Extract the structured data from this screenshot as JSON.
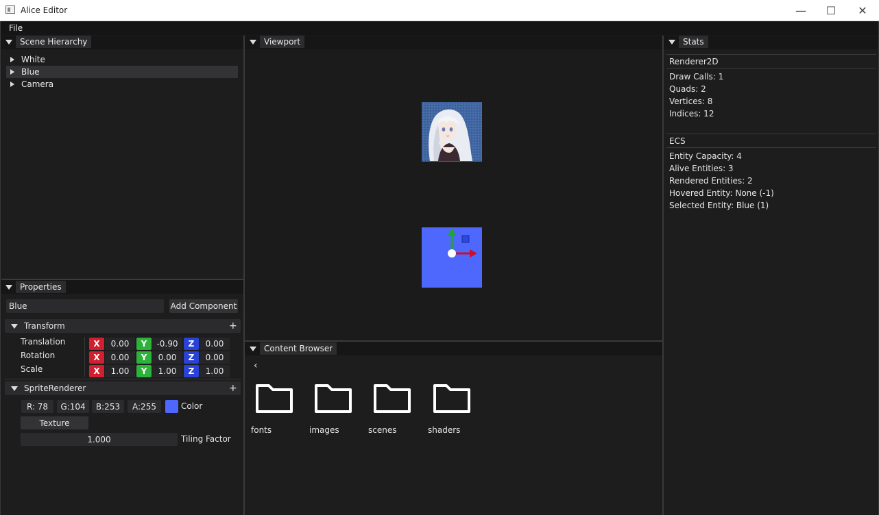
{
  "window": {
    "title": "Alice Editor",
    "controls": {
      "minimize": "—",
      "maximize": "☐",
      "close": "✕"
    }
  },
  "menu": {
    "file": "File"
  },
  "hierarchy": {
    "tab": "Scene Hierarchy",
    "items": [
      {
        "label": "White"
      },
      {
        "label": "Blue",
        "selected": true
      },
      {
        "label": "Camera"
      }
    ]
  },
  "properties": {
    "tab": "Properties",
    "name_value": "Blue",
    "add_component": "Add Component",
    "transform": {
      "header": "Transform",
      "add": "+",
      "rows": [
        {
          "label": "Translation",
          "x": "0.00",
          "y": "-0.90",
          "z": "0.00"
        },
        {
          "label": "Rotation",
          "x": "0.00",
          "y": "0.00",
          "z": "0.00"
        },
        {
          "label": "Scale",
          "x": "1.00",
          "y": "1.00",
          "z": "1.00"
        }
      ],
      "axis_labels": {
        "x": "X",
        "y": "Y",
        "z": "Z"
      }
    },
    "sprite": {
      "header": "SpriteRenderer",
      "add": "+",
      "r": "R: 78",
      "g": "G:104",
      "b": "B:253",
      "a": "A:255",
      "color_label": "Color",
      "color_swatch": "#4e68fd",
      "texture": "Texture",
      "tiling_value": "1.000",
      "tiling_label": "Tiling Factor"
    }
  },
  "viewport": {
    "tab": "Viewport"
  },
  "content_browser": {
    "tab": "Content Browser",
    "back": "‹",
    "folders": [
      "fonts",
      "images",
      "scenes",
      "shaders"
    ]
  },
  "stats": {
    "tab": "Stats",
    "renderer_header": "Renderer2D",
    "renderer_lines": [
      "Draw Calls: 1",
      "Quads: 2",
      "Vertices: 8",
      "Indices: 12"
    ],
    "ecs_header": "ECS",
    "ecs_lines": [
      "Entity Capacity: 4",
      "Alive Entities: 3",
      "Rendered Entities: 2",
      "Hovered Entity: None (-1)",
      "Selected Entity: Blue (1)"
    ]
  },
  "colors": {
    "accent_blue": "#4e68fd",
    "axis_x": "#d02030",
    "axis_y": "#2db33a",
    "axis_z": "#2a42d6"
  }
}
